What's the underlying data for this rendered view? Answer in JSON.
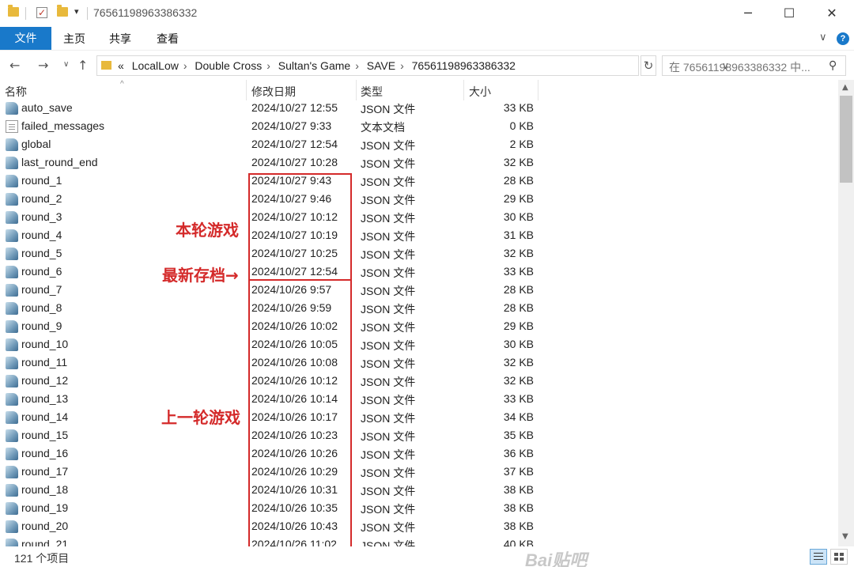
{
  "window": {
    "title": "76561198963386332"
  },
  "ribbon": {
    "tabs": [
      {
        "label": "文件"
      },
      {
        "label": "主页"
      },
      {
        "label": "共享"
      },
      {
        "label": "查看"
      }
    ]
  },
  "address": {
    "overflow": "«",
    "crumbs": [
      "LocalLow",
      "Double Cross",
      "Sultan's Game",
      "SAVE",
      "76561198963386332"
    ],
    "search_placeholder": "在 76561198963386332 中..."
  },
  "columns": {
    "name": "名称",
    "date": "修改日期",
    "type": "类型",
    "size": "大小"
  },
  "files": [
    {
      "name": "auto_save",
      "date": "2024/10/27 12:55",
      "type": "JSON 文件",
      "size": "33 KB",
      "icon": "json-file-icon"
    },
    {
      "name": "failed_messages",
      "date": "2024/10/27 9:33",
      "type": "文本文档",
      "size": "0 KB",
      "icon": "text-file-icon"
    },
    {
      "name": "global",
      "date": "2024/10/27 12:54",
      "type": "JSON 文件",
      "size": "2 KB",
      "icon": "json-file-icon"
    },
    {
      "name": "last_round_end",
      "date": "2024/10/27 10:28",
      "type": "JSON 文件",
      "size": "32 KB",
      "icon": "json-file-icon"
    },
    {
      "name": "round_1",
      "date": "2024/10/27 9:43",
      "type": "JSON 文件",
      "size": "28 KB",
      "icon": "json-file-icon"
    },
    {
      "name": "round_2",
      "date": "2024/10/27 9:46",
      "type": "JSON 文件",
      "size": "29 KB",
      "icon": "json-file-icon"
    },
    {
      "name": "round_3",
      "date": "2024/10/27 10:12",
      "type": "JSON 文件",
      "size": "30 KB",
      "icon": "json-file-icon"
    },
    {
      "name": "round_4",
      "date": "2024/10/27 10:19",
      "type": "JSON 文件",
      "size": "31 KB",
      "icon": "json-file-icon"
    },
    {
      "name": "round_5",
      "date": "2024/10/27 10:25",
      "type": "JSON 文件",
      "size": "32 KB",
      "icon": "json-file-icon"
    },
    {
      "name": "round_6",
      "date": "2024/10/27 12:54",
      "type": "JSON 文件",
      "size": "33 KB",
      "icon": "json-file-icon"
    },
    {
      "name": "round_7",
      "date": "2024/10/26 9:57",
      "type": "JSON 文件",
      "size": "28 KB",
      "icon": "json-file-icon"
    },
    {
      "name": "round_8",
      "date": "2024/10/26 9:59",
      "type": "JSON 文件",
      "size": "28 KB",
      "icon": "json-file-icon"
    },
    {
      "name": "round_9",
      "date": "2024/10/26 10:02",
      "type": "JSON 文件",
      "size": "29 KB",
      "icon": "json-file-icon"
    },
    {
      "name": "round_10",
      "date": "2024/10/26 10:05",
      "type": "JSON 文件",
      "size": "30 KB",
      "icon": "json-file-icon"
    },
    {
      "name": "round_11",
      "date": "2024/10/26 10:08",
      "type": "JSON 文件",
      "size": "32 KB",
      "icon": "json-file-icon"
    },
    {
      "name": "round_12",
      "date": "2024/10/26 10:12",
      "type": "JSON 文件",
      "size": "32 KB",
      "icon": "json-file-icon"
    },
    {
      "name": "round_13",
      "date": "2024/10/26 10:14",
      "type": "JSON 文件",
      "size": "33 KB",
      "icon": "json-file-icon"
    },
    {
      "name": "round_14",
      "date": "2024/10/26 10:17",
      "type": "JSON 文件",
      "size": "34 KB",
      "icon": "json-file-icon"
    },
    {
      "name": "round_15",
      "date": "2024/10/26 10:23",
      "type": "JSON 文件",
      "size": "35 KB",
      "icon": "json-file-icon"
    },
    {
      "name": "round_16",
      "date": "2024/10/26 10:26",
      "type": "JSON 文件",
      "size": "36 KB",
      "icon": "json-file-icon"
    },
    {
      "name": "round_17",
      "date": "2024/10/26 10:29",
      "type": "JSON 文件",
      "size": "37 KB",
      "icon": "json-file-icon"
    },
    {
      "name": "round_18",
      "date": "2024/10/26 10:31",
      "type": "JSON 文件",
      "size": "38 KB",
      "icon": "json-file-icon"
    },
    {
      "name": "round_19",
      "date": "2024/10/26 10:35",
      "type": "JSON 文件",
      "size": "38 KB",
      "icon": "json-file-icon"
    },
    {
      "name": "round_20",
      "date": "2024/10/26 10:43",
      "type": "JSON 文件",
      "size": "38 KB",
      "icon": "json-file-icon"
    },
    {
      "name": "round_21",
      "date": "2024/10/26 11:02",
      "type": "JSON 文件",
      "size": "40 KB",
      "icon": "json-file-icon"
    }
  ],
  "annotations": {
    "current_round": "本轮游戏",
    "latest_save": "最新存档→",
    "previous_round": "上一轮游戏",
    "color": "#d42a2a"
  },
  "status": {
    "item_count": "121 个项目"
  },
  "watermark": "Bai贴吧",
  "colors": {
    "accent": "#1979ca",
    "annotation": "#d42a2a"
  }
}
